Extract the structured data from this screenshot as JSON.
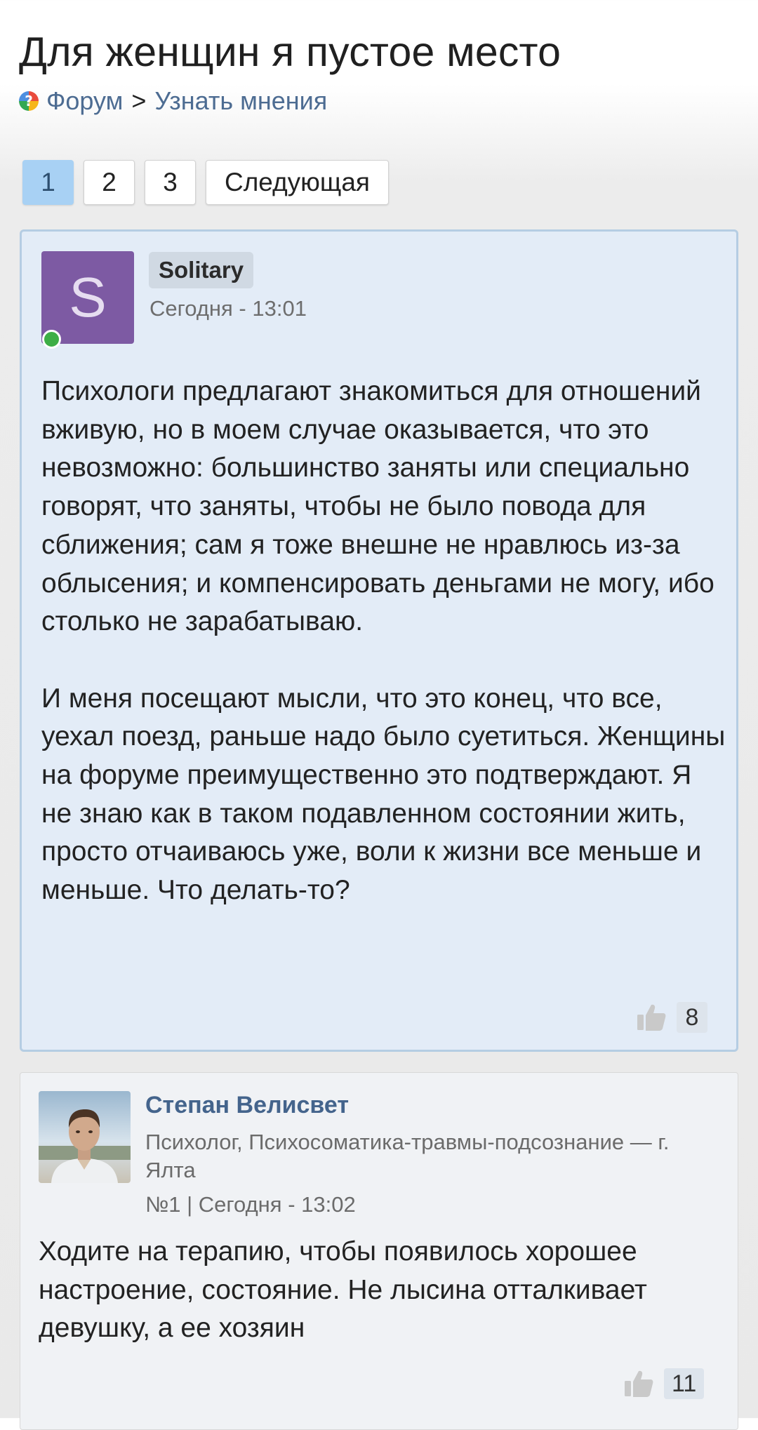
{
  "page": {
    "title": "Для женщин я пустое место"
  },
  "breadcrumb": {
    "forum_label": "Форум",
    "separator": ">",
    "section_label": "Узнать мнения"
  },
  "pagination": {
    "pages": [
      "1",
      "2",
      "3"
    ],
    "active_page": "1",
    "next_label": "Следующая"
  },
  "main_post": {
    "avatar_letter": "S",
    "avatar_color": "#7d5aa3",
    "online": true,
    "author": "Solitary",
    "time": "Сегодня - 13:01",
    "paragraphs": [
      "Психологи предлагают знакомиться для отношений вживую, но в моем случае оказывается, что это невозможно: большинство заняты или специально говорят, что заняты, чтобы не было повода для сближения; сам я тоже внешне не нравлюсь из-за облысения; и компенсировать деньгами не могу, ибо столько не зарабатываю.",
      "И меня посещают мысли, что это конец, что все, уехал поезд, раньше надо было суетиться. Женщины на форуме преимущественно это подтверждают. Я не знаю как в таком подавленном состоянии жить, просто отчаиваюсь уже, воли к жизни все меньше и меньше. Что делать-то?"
    ],
    "likes": "8"
  },
  "reply_post": {
    "author": "Степан Велисвет",
    "role": "Психолог, Психосоматика-травмы-подсознание — г. Ялта",
    "meta": "№1 | Сегодня - 13:02",
    "text": "Ходите на терапию, чтобы появилось хорошее настроение, состояние. Не лысина отталкивает девушку, а ее хозяин",
    "likes": "11"
  },
  "colors": {
    "accent_link": "#4d6c92",
    "active_page_bg": "#a8d1f4",
    "main_post_bg": "#e3ecf7",
    "main_post_border": "#b5cde3",
    "online_dot": "#3dae46"
  },
  "icons": {
    "like": "thumbs-up-icon",
    "forum": "forum-logo-icon"
  }
}
